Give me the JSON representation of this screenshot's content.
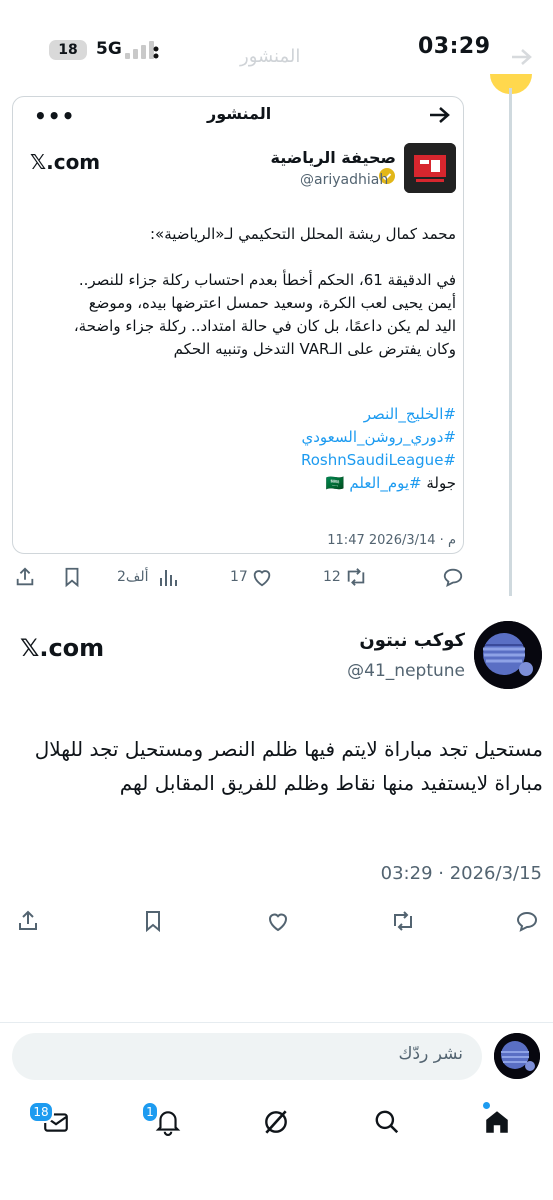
{
  "status_bar": {
    "time": "03:29",
    "battery": "18",
    "network": "5G"
  },
  "background_header": {
    "title": "المنشور"
  },
  "embedded_card": {
    "header_title": "المنشور",
    "site": "𝕏.com",
    "author_name": "صحيفة الرياضية",
    "author_handle": "@ariyadhiah",
    "body": [
      "محمد كمال ريشة المحلل التحكيمي لـ«الرياضية»:",
      "",
      "في الدقيقة 61، الحكم أخطأ بعدم احتساب ركلة جزاء للنصر..",
      "أيمن يحيى لعب الكرة، وسعيد حمسل اعترضها بيده، وموضع",
      "اليد لم يكن داعمًا، بل كان في حالة امتداد.. ركلة جزاء واضحة،",
      "وكان يفترض على الـVAR التدخل وتنبيه الحكم"
    ],
    "hashtags": [
      "#الخليج_النصر",
      "#دوري_روشن_السعودي",
      "#RoshnSaudiLeague"
    ],
    "last_line_prefix": "جولة ",
    "last_line_tag": "#يوم_العلم",
    "last_line_flag": "🇸🇦",
    "timestamp": "11:47 م · 2026/3/14",
    "views": "2ألف",
    "retweets": "12",
    "likes": "17"
  },
  "main_tweet": {
    "site": "𝕏.com",
    "author_name": "كوكب نبتون",
    "author_handle": "@41_neptune",
    "text": "مستحيل تجد مباراة لايتم فيها ظلم النصر ومستحيل تجد للهلال مباراة لايستفيد منها نقاط وظلم للفريق المقابل لهم",
    "timestamp": "03:29 · 2026/3/15"
  },
  "reply": {
    "placeholder": "نشر ردّك"
  },
  "bottom_nav": {
    "messages_badge": "18",
    "notifications_badge": "1",
    "items": [
      "messages-icon",
      "notifications-icon",
      "grok-icon",
      "search-icon",
      "home-icon"
    ]
  },
  "colors": {
    "accent": "#1d9bf0",
    "text": "#0f1419",
    "secondary": "#536471"
  }
}
